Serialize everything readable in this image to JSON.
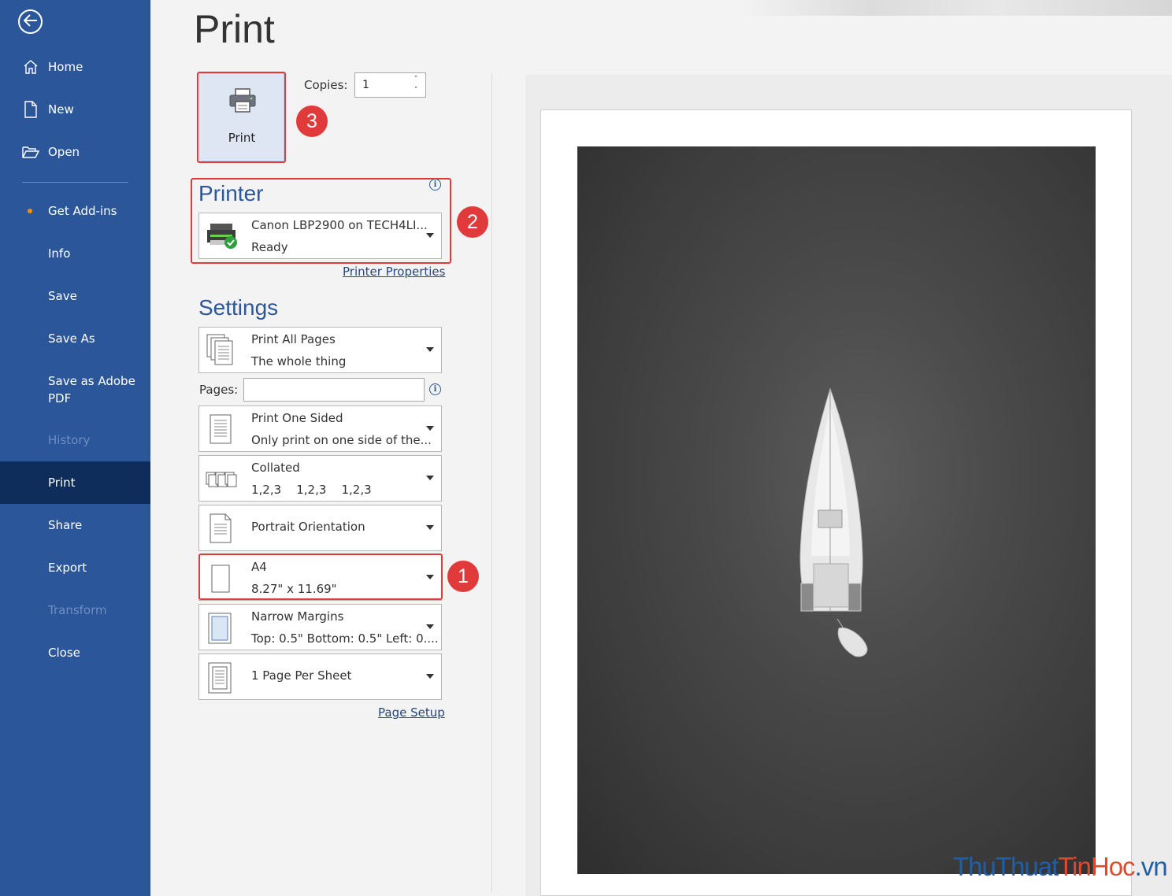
{
  "sidebar": {
    "items": [
      {
        "label": "Home",
        "icon": "home-icon"
      },
      {
        "label": "New",
        "icon": "new-document-icon"
      },
      {
        "label": "Open",
        "icon": "open-folder-icon"
      },
      {
        "label": "Get Add-ins"
      },
      {
        "label": "Info"
      },
      {
        "label": "Save"
      },
      {
        "label": "Save As"
      },
      {
        "label": "Save as Adobe PDF"
      },
      {
        "label": "History",
        "disabled": true
      },
      {
        "label": "Print",
        "active": true
      },
      {
        "label": "Share"
      },
      {
        "label": "Export"
      },
      {
        "label": "Transform",
        "disabled": true
      },
      {
        "label": "Close"
      }
    ]
  },
  "page": {
    "title": "Print"
  },
  "print_button": {
    "label": "Print"
  },
  "copies": {
    "label": "Copies:",
    "value": "1"
  },
  "printer": {
    "section_title": "Printer",
    "name": "Canon LBP2900 on TECH4LI...",
    "status": "Ready",
    "properties_link": "Printer Properties"
  },
  "settings": {
    "section_title": "Settings",
    "print_range": {
      "line1": "Print All Pages",
      "line2": "The whole thing"
    },
    "pages_label": "Pages:",
    "pages_value": "",
    "sides": {
      "line1": "Print One Sided",
      "line2": "Only print on one side of the..."
    },
    "collation": {
      "line1": "Collated",
      "line2": "1,2,3    1,2,3    1,2,3"
    },
    "orientation": {
      "line1": "Portrait Orientation"
    },
    "paper": {
      "line1": "A4",
      "line2": "8.27\" x 11.69\""
    },
    "margins": {
      "line1": "Narrow Margins",
      "line2": "Top: 0.5\" Bottom: 0.5\" Left: 0...."
    },
    "pages_per_sheet": {
      "line1": "1 Page Per Sheet"
    },
    "page_setup_link": "Page Setup"
  },
  "annotations": {
    "badge1": "1",
    "badge2": "2",
    "badge3": "3"
  },
  "watermark": {
    "part1": "ThuThuat",
    "part2": "TinHoc",
    "part3": ".vn"
  },
  "colors": {
    "sidebar": "#2b579a",
    "active": "#0e2d5a",
    "highlight": "#e03a3a",
    "accent_dot": "#f29100"
  }
}
